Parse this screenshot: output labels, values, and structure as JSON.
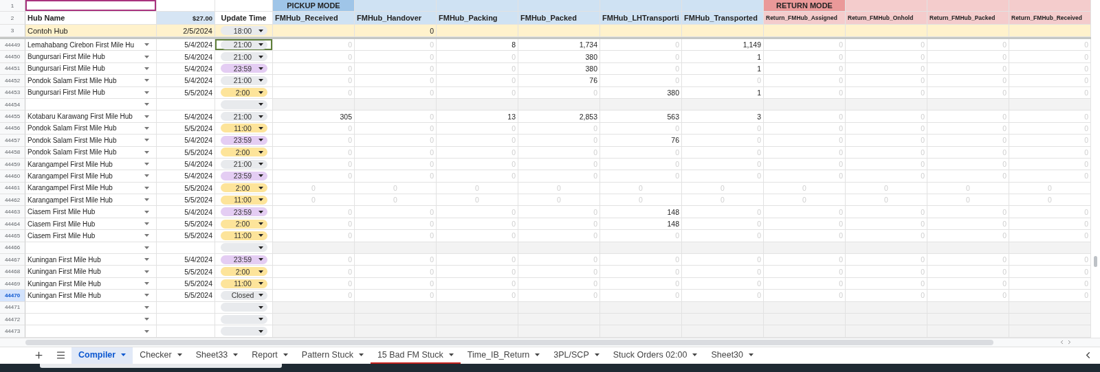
{
  "header_rows": {
    "band_number": "1",
    "label_number": "2",
    "hub_label": "Hub Name",
    "date_label": "$27.00",
    "time_label": "Update Time",
    "hub_cell_outlined": true
  },
  "columns": [
    {
      "label": "FMHub_Received",
      "kind": "pickup",
      "band": "PICKUP MODE"
    },
    {
      "label": "FMHub_Handover",
      "kind": "pickup"
    },
    {
      "label": "FMHub_Packing",
      "kind": "pickup"
    },
    {
      "label": "FMHub_Packed",
      "kind": "pickup"
    },
    {
      "label": "FMHub_LHTransporti",
      "kind": "pickup"
    },
    {
      "label": "FMHub_Transported",
      "kind": "pickup"
    },
    {
      "label": "Return_FMHub_Assigned",
      "kind": "return",
      "band": "RETURN MODE"
    },
    {
      "label": "Return_FMHub_Onhold",
      "kind": "return"
    },
    {
      "label": "Return_FMHub_Packed",
      "kind": "return"
    },
    {
      "label": "Return_FMHub_Received",
      "kind": "return"
    }
  ],
  "sample_row": {
    "number": "3",
    "hub": "Contoh Hub",
    "date": "2/5/2024",
    "time": {
      "text": "18:00",
      "color": "#e8eaed"
    },
    "cells": [
      null,
      {
        "text": "0",
        "muted": false
      },
      null,
      null,
      null,
      null,
      null,
      null,
      null,
      null
    ]
  },
  "rows": [
    {
      "number": "44449",
      "kind": "data",
      "selected": false,
      "hub": "Lemahabang Cirebon First Mile Hu",
      "date": "5/4/2024",
      "time": {
        "text": "21:00",
        "color": "#e8eaed",
        "focused": true
      },
      "cells": [
        {
          "text": "0",
          "muted": true
        },
        {
          "text": "0",
          "muted": true
        },
        {
          "text": "8",
          "muted": false
        },
        {
          "text": "1,734",
          "muted": false
        },
        {
          "text": "0",
          "muted": true
        },
        {
          "text": "1,149",
          "muted": false
        },
        {
          "text": "0",
          "muted": true
        },
        {
          "text": "0",
          "muted": true
        },
        {
          "text": "0",
          "muted": true
        },
        {
          "text": "0",
          "muted": true
        }
      ]
    },
    {
      "number": "44450",
      "kind": "data",
      "selected": false,
      "hub": "Bungursari First Mile Hub",
      "date": "5/4/2024",
      "time": {
        "text": "21:00",
        "color": "#e8eaed",
        "focused": false
      },
      "cells": [
        {
          "text": "0",
          "muted": true
        },
        {
          "text": "0",
          "muted": true
        },
        {
          "text": "0",
          "muted": true
        },
        {
          "text": "380",
          "muted": false
        },
        {
          "text": "0",
          "muted": true
        },
        {
          "text": "1",
          "muted": false
        },
        {
          "text": "0",
          "muted": true
        },
        {
          "text": "0",
          "muted": true
        },
        {
          "text": "0",
          "muted": true
        },
        {
          "text": "0",
          "muted": true
        }
      ]
    },
    {
      "number": "44451",
      "kind": "data",
      "selected": false,
      "hub": "Bungursari First Mile Hub",
      "date": "5/4/2024",
      "time": {
        "text": "23:59",
        "color": "#e4cdf3",
        "focused": false
      },
      "cells": [
        {
          "text": "0",
          "muted": true
        },
        {
          "text": "0",
          "muted": true
        },
        {
          "text": "0",
          "muted": true
        },
        {
          "text": "380",
          "muted": false
        },
        {
          "text": "0",
          "muted": true
        },
        {
          "text": "1",
          "muted": false
        },
        {
          "text": "0",
          "muted": true
        },
        {
          "text": "0",
          "muted": true
        },
        {
          "text": "0",
          "muted": true
        },
        {
          "text": "0",
          "muted": true
        }
      ]
    },
    {
      "number": "44452",
      "kind": "data",
      "selected": false,
      "hub": "Pondok Salam First Mile Hub",
      "date": "5/4/2024",
      "time": {
        "text": "21:00",
        "color": "#e8eaed",
        "focused": false
      },
      "cells": [
        {
          "text": "0",
          "muted": true
        },
        {
          "text": "0",
          "muted": true
        },
        {
          "text": "0",
          "muted": true
        },
        {
          "text": "76",
          "muted": false
        },
        {
          "text": "0",
          "muted": true
        },
        {
          "text": "0",
          "muted": true
        },
        {
          "text": "0",
          "muted": true
        },
        {
          "text": "0",
          "muted": true
        },
        {
          "text": "0",
          "muted": true
        },
        {
          "text": "0",
          "muted": true
        }
      ]
    },
    {
      "number": "44453",
      "kind": "data",
      "selected": false,
      "hub": "Bungursari First Mile Hub",
      "date": "5/5/2024",
      "time": {
        "text": "2:00",
        "color": "#fde49a",
        "focused": false
      },
      "cells": [
        {
          "text": "0",
          "muted": true
        },
        {
          "text": "0",
          "muted": true
        },
        {
          "text": "0",
          "muted": true
        },
        {
          "text": "0",
          "muted": true
        },
        {
          "text": "380",
          "muted": false
        },
        {
          "text": "1",
          "muted": false
        },
        {
          "text": "0",
          "muted": true
        },
        {
          "text": "0",
          "muted": true
        },
        {
          "text": "0",
          "muted": true
        },
        {
          "text": "0",
          "muted": true
        }
      ]
    },
    {
      "number": "44454",
      "kind": "blank",
      "selected": false,
      "time": {
        "color": "#e8eaed",
        "focused": false
      }
    },
    {
      "number": "44455",
      "kind": "data",
      "selected": false,
      "hub": "Kotabaru Karawang First Mile Hub",
      "date": "5/4/2024",
      "time": {
        "text": "21:00",
        "color": "#e8eaed",
        "focused": false
      },
      "cells": [
        {
          "text": "305",
          "muted": false
        },
        {
          "text": "0",
          "muted": true
        },
        {
          "text": "13",
          "muted": false
        },
        {
          "text": "2,853",
          "muted": false
        },
        {
          "text": "563",
          "muted": false
        },
        {
          "text": "3",
          "muted": false
        },
        {
          "text": "0",
          "muted": true
        },
        {
          "text": "0",
          "muted": true
        },
        {
          "text": "0",
          "muted": true
        },
        {
          "text": "0",
          "muted": true
        }
      ]
    },
    {
      "number": "44456",
      "kind": "data",
      "selected": false,
      "hub": "Pondok Salam First Mile Hub",
      "date": "5/5/2024",
      "time": {
        "text": "11:00",
        "color": "#fde49a",
        "focused": false
      },
      "cells": [
        {
          "text": "0",
          "muted": true
        },
        {
          "text": "0",
          "muted": true
        },
        {
          "text": "0",
          "muted": true
        },
        {
          "text": "0",
          "muted": true
        },
        {
          "text": "0",
          "muted": true
        },
        {
          "text": "0",
          "muted": true
        },
        {
          "text": "0",
          "muted": true
        },
        {
          "text": "0",
          "muted": true
        },
        {
          "text": "0",
          "muted": true
        },
        {
          "text": "0",
          "muted": true
        }
      ]
    },
    {
      "number": "44457",
      "kind": "data",
      "selected": false,
      "hub": "Pondok Salam First Mile Hub",
      "date": "5/4/2024",
      "time": {
        "text": "23:59",
        "color": "#e4cdf3",
        "focused": false
      },
      "cells": [
        {
          "text": "0",
          "muted": true
        },
        {
          "text": "0",
          "muted": true
        },
        {
          "text": "0",
          "muted": true
        },
        {
          "text": "0",
          "muted": true
        },
        {
          "text": "76",
          "muted": false
        },
        {
          "text": "0",
          "muted": true
        },
        {
          "text": "0",
          "muted": true
        },
        {
          "text": "0",
          "muted": true
        },
        {
          "text": "0",
          "muted": true
        },
        {
          "text": "0",
          "muted": true
        }
      ]
    },
    {
      "number": "44458",
      "kind": "data",
      "selected": false,
      "hub": "Pondok Salam First Mile Hub",
      "date": "5/5/2024",
      "time": {
        "text": "2:00",
        "color": "#fde49a",
        "focused": false
      },
      "cells": [
        {
          "text": "0",
          "muted": true
        },
        {
          "text": "0",
          "muted": true
        },
        {
          "text": "0",
          "muted": true
        },
        {
          "text": "0",
          "muted": true
        },
        {
          "text": "0",
          "muted": true
        },
        {
          "text": "0",
          "muted": true
        },
        {
          "text": "0",
          "muted": true
        },
        {
          "text": "0",
          "muted": true
        },
        {
          "text": "0",
          "muted": true
        },
        {
          "text": "0",
          "muted": true
        }
      ]
    },
    {
      "number": "44459",
      "kind": "data",
      "selected": false,
      "hub": "Karangampel First Mile Hub",
      "date": "5/4/2024",
      "time": {
        "text": "21:00",
        "color": "#e8eaed",
        "focused": false
      },
      "cells": [
        {
          "text": "0",
          "muted": true
        },
        {
          "text": "0",
          "muted": true
        },
        {
          "text": "0",
          "muted": true
        },
        {
          "text": "0",
          "muted": true
        },
        {
          "text": "0",
          "muted": true
        },
        {
          "text": "0",
          "muted": true
        },
        {
          "text": "0",
          "muted": true
        },
        {
          "text": "0",
          "muted": true
        },
        {
          "text": "0",
          "muted": true
        },
        {
          "text": "0",
          "muted": true
        }
      ]
    },
    {
      "number": "44460",
      "kind": "data",
      "selected": false,
      "hub": "Karangampel First Mile Hub",
      "date": "5/4/2024",
      "time": {
        "text": "23:59",
        "color": "#e4cdf3",
        "focused": false
      },
      "cells": [
        {
          "text": "0",
          "muted": true
        },
        {
          "text": "0",
          "muted": true
        },
        {
          "text": "0",
          "muted": true
        },
        {
          "text": "0",
          "muted": true
        },
        {
          "text": "0",
          "muted": true
        },
        {
          "text": "0",
          "muted": true
        },
        {
          "text": "0",
          "muted": true
        },
        {
          "text": "0",
          "muted": true
        },
        {
          "text": "0",
          "muted": true
        },
        {
          "text": "0",
          "muted": true
        }
      ]
    },
    {
      "number": "44461",
      "kind": "faded",
      "selected": false,
      "hub": "Karangampel First Mile Hub",
      "date": "5/5/2024",
      "time": {
        "text": "2:00",
        "color": "#fde49a",
        "focused": false
      },
      "cells": [
        {
          "text": "0",
          "muted": true
        },
        {
          "text": "0",
          "muted": true
        },
        {
          "text": "0",
          "muted": true
        },
        {
          "text": "0",
          "muted": true
        },
        {
          "text": "0",
          "muted": true
        },
        {
          "text": "0",
          "muted": true
        },
        {
          "text": "0",
          "muted": true
        },
        {
          "text": "0",
          "muted": true
        },
        {
          "text": "0",
          "muted": true
        },
        {
          "text": "0",
          "muted": true
        }
      ]
    },
    {
      "number": "44462",
      "kind": "faded",
      "selected": false,
      "hub": "Karangampel First Mile Hub",
      "date": "5/5/2024",
      "time": {
        "text": "11:00",
        "color": "#fde49a",
        "focused": false
      },
      "cells": [
        {
          "text": "0",
          "muted": true
        },
        {
          "text": "0",
          "muted": true
        },
        {
          "text": "0",
          "muted": true
        },
        {
          "text": "0",
          "muted": true
        },
        {
          "text": "0",
          "muted": true
        },
        {
          "text": "0",
          "muted": true
        },
        {
          "text": "0",
          "muted": true
        },
        {
          "text": "0",
          "muted": true
        },
        {
          "text": "0",
          "muted": true
        },
        {
          "text": "0",
          "muted": true
        }
      ]
    },
    {
      "number": "44463",
      "kind": "data",
      "selected": false,
      "hub": "Ciasem First Mile Hub",
      "date": "5/4/2024",
      "time": {
        "text": "23:59",
        "color": "#e4cdf3",
        "focused": false
      },
      "cells": [
        {
          "text": "0",
          "muted": true
        },
        {
          "text": "0",
          "muted": true
        },
        {
          "text": "0",
          "muted": true
        },
        {
          "text": "0",
          "muted": true
        },
        {
          "text": "148",
          "muted": false
        },
        {
          "text": "0",
          "muted": true
        },
        {
          "text": "0",
          "muted": true
        },
        {
          "text": "0",
          "muted": true
        },
        {
          "text": "0",
          "muted": true
        },
        {
          "text": "0",
          "muted": true
        }
      ]
    },
    {
      "number": "44464",
      "kind": "data",
      "selected": false,
      "hub": "Ciasem First Mile Hub",
      "date": "5/5/2024",
      "time": {
        "text": "2:00",
        "color": "#fde49a",
        "focused": false
      },
      "cells": [
        {
          "text": "0",
          "muted": true
        },
        {
          "text": "0",
          "muted": true
        },
        {
          "text": "0",
          "muted": true
        },
        {
          "text": "0",
          "muted": true
        },
        {
          "text": "148",
          "muted": false
        },
        {
          "text": "0",
          "muted": true
        },
        {
          "text": "0",
          "muted": true
        },
        {
          "text": "0",
          "muted": true
        },
        {
          "text": "0",
          "muted": true
        },
        {
          "text": "0",
          "muted": true
        }
      ]
    },
    {
      "number": "44465",
      "kind": "data",
      "selected": false,
      "hub": "Ciasem First Mile Hub",
      "date": "5/5/2024",
      "time": {
        "text": "11:00",
        "color": "#fde49a",
        "focused": false
      },
      "cells": [
        {
          "text": "0",
          "muted": true
        },
        {
          "text": "0",
          "muted": true
        },
        {
          "text": "0",
          "muted": true
        },
        {
          "text": "0",
          "muted": true
        },
        {
          "text": "0",
          "muted": true
        },
        {
          "text": "0",
          "muted": true
        },
        {
          "text": "0",
          "muted": true
        },
        {
          "text": "0",
          "muted": true
        },
        {
          "text": "0",
          "muted": true
        },
        {
          "text": "0",
          "muted": true
        }
      ]
    },
    {
      "number": "44466",
      "kind": "blank",
      "selected": false,
      "time": {
        "color": "#e8eaed",
        "focused": false
      }
    },
    {
      "number": "44467",
      "kind": "data",
      "selected": false,
      "hub": "Kuningan First Mile Hub",
      "date": "5/4/2024",
      "time": {
        "text": "23:59",
        "color": "#e4cdf3",
        "focused": false
      },
      "cells": [
        {
          "text": "0",
          "muted": true
        },
        {
          "text": "0",
          "muted": true
        },
        {
          "text": "0",
          "muted": true
        },
        {
          "text": "0",
          "muted": true
        },
        {
          "text": "0",
          "muted": true
        },
        {
          "text": "0",
          "muted": true
        },
        {
          "text": "0",
          "muted": true
        },
        {
          "text": "0",
          "muted": true
        },
        {
          "text": "0",
          "muted": true
        },
        {
          "text": "0",
          "muted": true
        }
      ]
    },
    {
      "number": "44468",
      "kind": "data",
      "selected": false,
      "hub": "Kuningan First Mile Hub",
      "date": "5/5/2024",
      "time": {
        "text": "2:00",
        "color": "#fde49a",
        "focused": false
      },
      "cells": [
        {
          "text": "0",
          "muted": true
        },
        {
          "text": "0",
          "muted": true
        },
        {
          "text": "0",
          "muted": true
        },
        {
          "text": "0",
          "muted": true
        },
        {
          "text": "0",
          "muted": true
        },
        {
          "text": "0",
          "muted": true
        },
        {
          "text": "0",
          "muted": true
        },
        {
          "text": "0",
          "muted": true
        },
        {
          "text": "0",
          "muted": true
        },
        {
          "text": "0",
          "muted": true
        }
      ]
    },
    {
      "number": "44469",
      "kind": "data",
      "selected": false,
      "hub": "Kuningan First Mile Hub",
      "date": "5/5/2024",
      "time": {
        "text": "11:00",
        "color": "#fde49a",
        "focused": false
      },
      "cells": [
        {
          "text": "0",
          "muted": true
        },
        {
          "text": "0",
          "muted": true
        },
        {
          "text": "0",
          "muted": true
        },
        {
          "text": "0",
          "muted": true
        },
        {
          "text": "0",
          "muted": true
        },
        {
          "text": "0",
          "muted": true
        },
        {
          "text": "0",
          "muted": true
        },
        {
          "text": "0",
          "muted": true
        },
        {
          "text": "0",
          "muted": true
        },
        {
          "text": "0",
          "muted": true
        }
      ]
    },
    {
      "number": "44470",
      "kind": "data",
      "selected": true,
      "hub": "Kuningan First Mile Hub",
      "date": "5/5/2024",
      "time": {
        "text": "Closed",
        "color": "#e8eaed",
        "focused": false
      },
      "cells": [
        {
          "text": "0",
          "muted": true
        },
        {
          "text": "0",
          "muted": true
        },
        {
          "text": "0",
          "muted": true
        },
        {
          "text": "0",
          "muted": true
        },
        {
          "text": "0",
          "muted": true
        },
        {
          "text": "0",
          "muted": true
        },
        {
          "text": "0",
          "muted": true
        },
        {
          "text": "0",
          "muted": true
        },
        {
          "text": "0",
          "muted": true
        },
        {
          "text": "0",
          "muted": true
        }
      ]
    },
    {
      "number": "44471",
      "kind": "blank",
      "selected": false,
      "time": {
        "color": "#e8eaed",
        "focused": false
      }
    },
    {
      "number": "44472",
      "kind": "blank",
      "selected": false,
      "time": {
        "color": "#e8eaed",
        "focused": false
      }
    },
    {
      "number": "44473",
      "kind": "blank",
      "selected": false,
      "time": {
        "color": "#e8eaed",
        "focused": false
      }
    }
  ],
  "tabs": [
    {
      "label": "Compiler",
      "selected": true
    },
    {
      "label": "Checker",
      "selected": false
    },
    {
      "label": "Sheet33",
      "selected": false
    },
    {
      "label": "Report",
      "selected": false
    },
    {
      "label": "Pattern Stuck",
      "selected": false
    },
    {
      "label": "15 Bad FM Stuck",
      "selected": false,
      "color": "#c5221f"
    },
    {
      "label": "Time_IB_Return",
      "selected": false
    },
    {
      "label": "3PL/SCP",
      "selected": false
    },
    {
      "label": "Stuck Orders 02:00",
      "selected": false
    },
    {
      "label": "Sheet30",
      "selected": false
    }
  ]
}
